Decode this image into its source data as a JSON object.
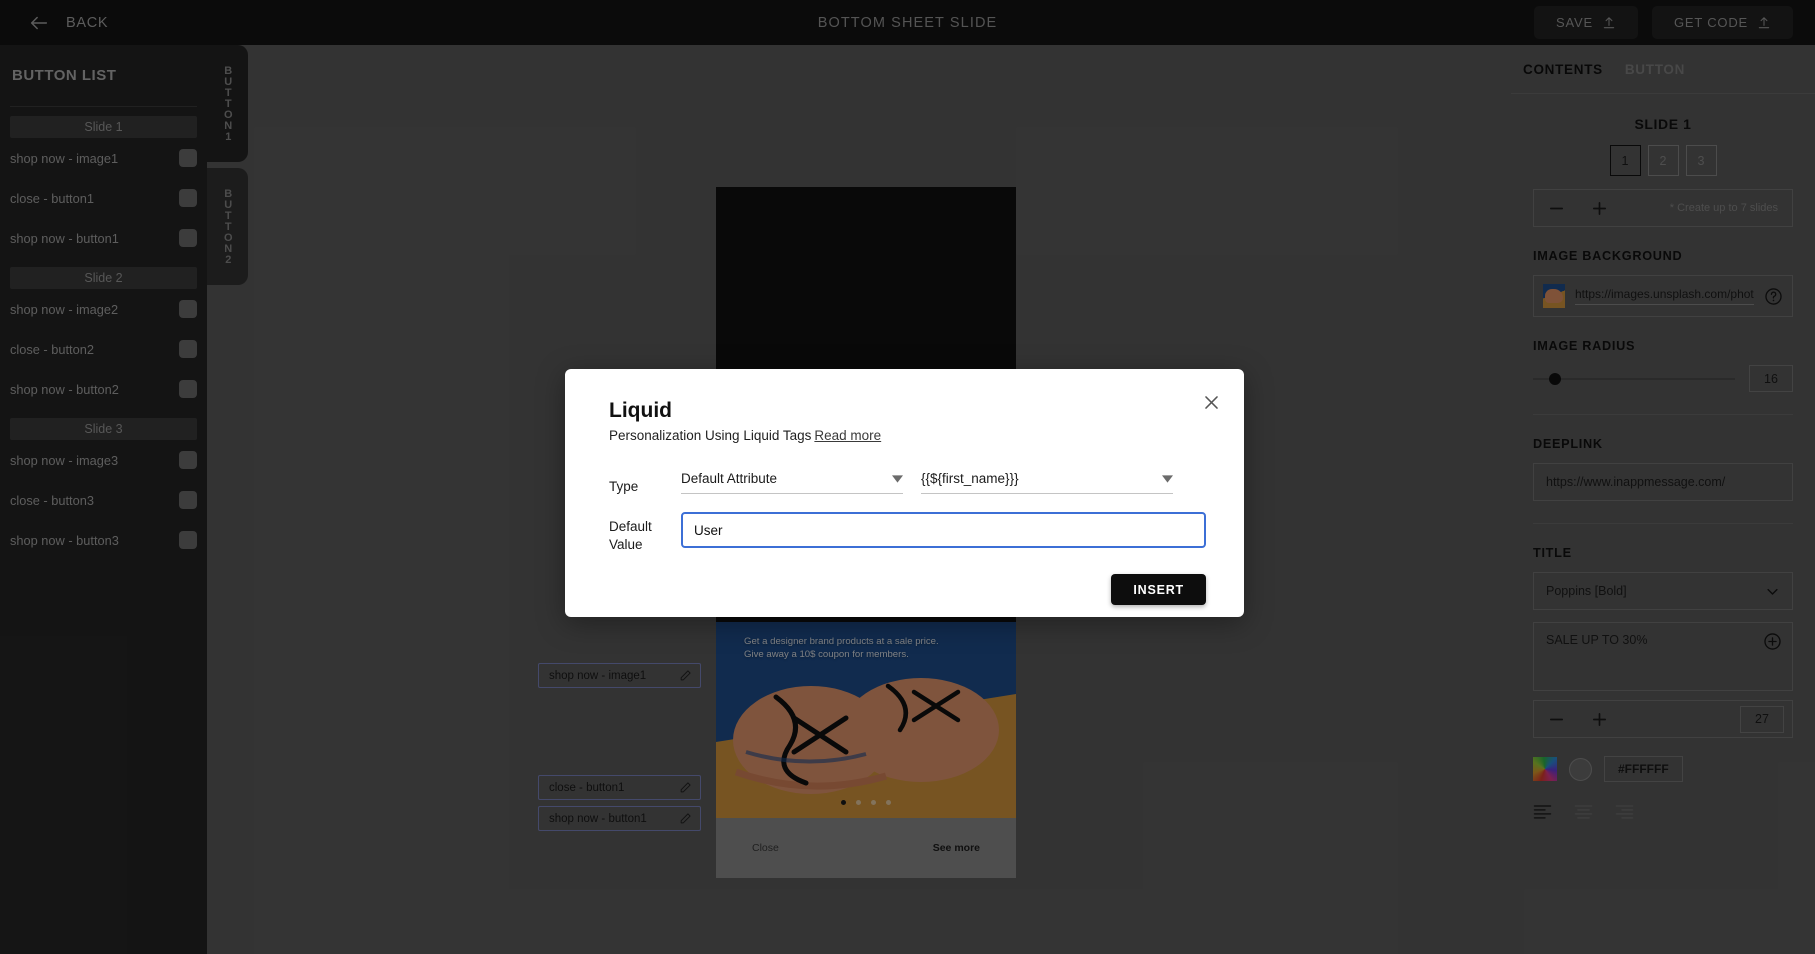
{
  "topbar": {
    "back_label": "BACK",
    "back_icon": "arrow-left-icon",
    "title": "BOTTOM SHEET SLIDE",
    "save_label": "SAVE",
    "get_code_label": "GET CODE",
    "upload_icon": "upload-icon"
  },
  "left_panel": {
    "title": "BUTTON LIST",
    "groups": [
      {
        "slide_label": "Slide 1",
        "items": [
          {
            "label": "shop now - image1"
          },
          {
            "label": "close - button1"
          },
          {
            "label": "shop now - button1"
          }
        ]
      },
      {
        "slide_label": "Slide 2",
        "items": [
          {
            "label": "shop now - image2"
          },
          {
            "label": "close - button2"
          },
          {
            "label": "shop now - button2"
          }
        ]
      },
      {
        "slide_label": "Slide 3",
        "items": [
          {
            "label": "shop now - image3"
          },
          {
            "label": "close - button3"
          },
          {
            "label": "shop now - button3"
          }
        ]
      }
    ]
  },
  "vertical_tabs": [
    {
      "label": "BUTTON1",
      "active": true
    },
    {
      "label": "BUTTON2",
      "active": false
    }
  ],
  "canvas": {
    "hero_text_line1": "Get a designer brand products at a sale price.",
    "hero_text_line2": "Give away a 10$ coupon for members.",
    "close_label": "Close",
    "see_more_label": "See more",
    "dots_count": 4,
    "active_dot_index": 0,
    "badges": [
      {
        "label": "shop now - image1",
        "icon": "pencil-icon"
      },
      {
        "label": "close - button1",
        "icon": "pencil-icon"
      },
      {
        "label": "shop now - button1",
        "icon": "pencil-icon"
      }
    ]
  },
  "right_panel": {
    "tabs": [
      {
        "label": "CONTENTS",
        "active": true
      },
      {
        "label": "BUTTON",
        "active": false
      }
    ],
    "slide_title": "SLIDE 1",
    "slide_numbers": [
      "1",
      "2",
      "3"
    ],
    "active_slide": "1",
    "slides_hint": "* Create up to 7 slides",
    "image_background_heading": "IMAGE BACKGROUND",
    "image_url": "https://images.unsplash.com/photo-...",
    "help_icon": "question-circle-icon",
    "image_radius_heading": "IMAGE RADIUS",
    "image_radius_value": "16",
    "deeplink_heading": "DEEPLINK",
    "deeplink_value": "https://www.inappmessage.com/",
    "title_heading": "TITLE",
    "font_value": "Poppins [Bold]",
    "title_text": "SALE UP TO 30%",
    "add_icon": "plus-circle-icon",
    "font_size_value": "27",
    "color_hex": "#FFFFFF",
    "minus_icon": "minus-icon",
    "plus_icon": "plus-icon",
    "align_icons": [
      "align-left-icon",
      "align-center-icon",
      "align-right-icon"
    ]
  },
  "modal": {
    "title": "Liquid",
    "subtitle": "Personalization Using Liquid Tags",
    "read_more": "Read more",
    "close_icon": "close-icon",
    "type_label": "Type",
    "type_value": "Default Attribute",
    "attribute_value": "{{${first_name}}}",
    "default_value_label_line1": "Default",
    "default_value_label_line2": "Value",
    "default_value": "User",
    "insert_label": "INSERT"
  },
  "colors": {
    "accent_blue": "#3c6fd6",
    "badge_border": "#7d85c4",
    "panel_dark": "#262626",
    "canvas_gray": "#5e5e5e"
  }
}
